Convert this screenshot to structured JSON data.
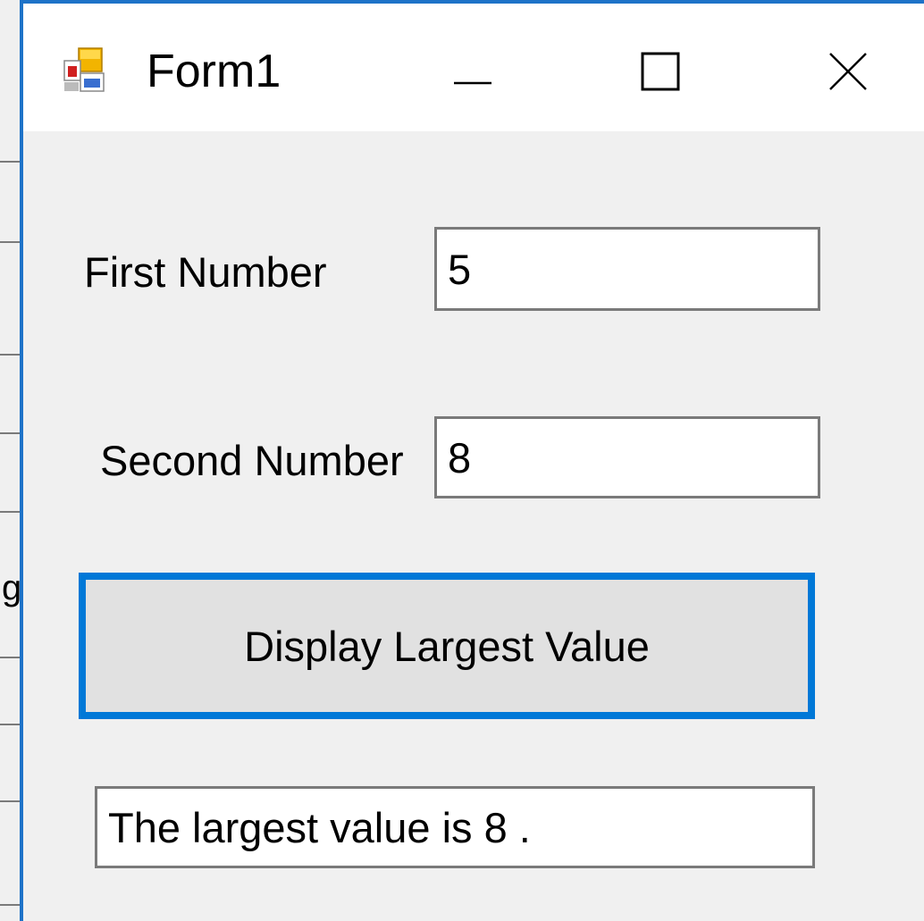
{
  "window": {
    "title": "Form1",
    "controls": {
      "minimize_icon": "minimize-icon",
      "maximize_icon": "maximize-icon",
      "close_icon": "close-icon"
    }
  },
  "form": {
    "first_label": "First Number",
    "first_value": "5",
    "second_label": "Second Number",
    "second_value": "8",
    "button_label": "Display Largest Value",
    "result_value": "The largest value is 8 ."
  },
  "background": {
    "ghost_char": "g"
  },
  "colors": {
    "accent": "#0078d7",
    "window_border": "#1e73c8",
    "client_bg": "#f0f0f0",
    "button_bg": "#e1e1e1",
    "textbox_border": "#7a7a7a"
  }
}
